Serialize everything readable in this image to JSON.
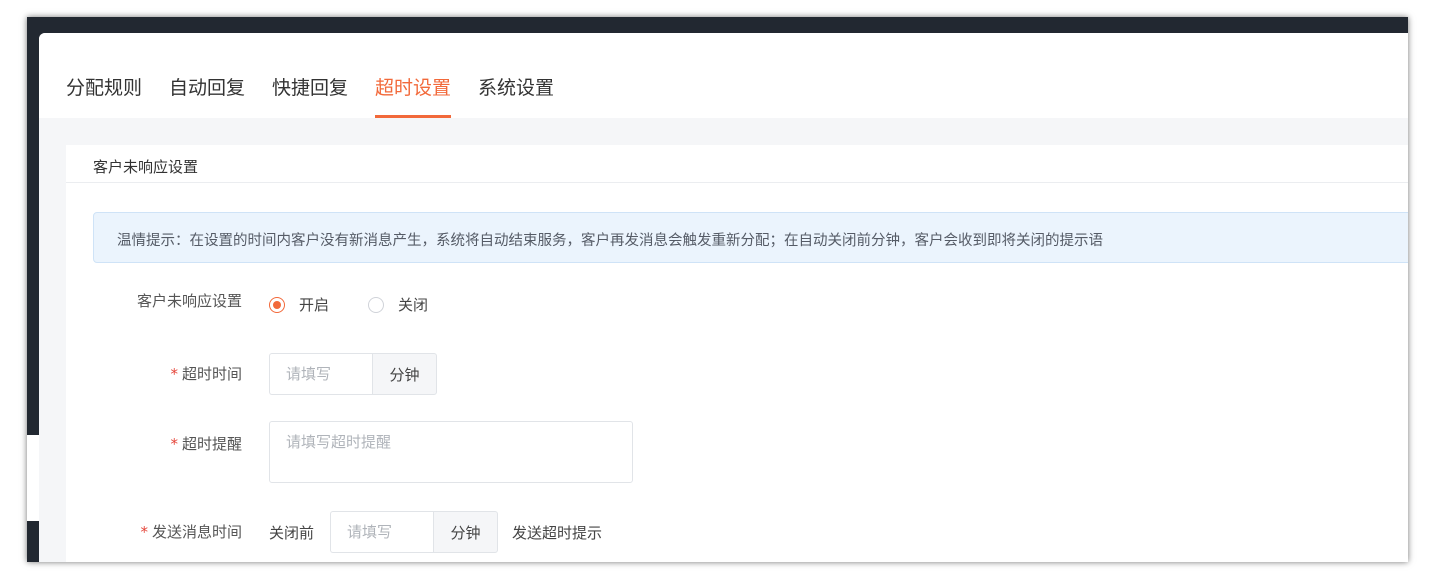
{
  "tabs": [
    {
      "label": "分配规则"
    },
    {
      "label": "自动回复"
    },
    {
      "label": "快捷回复"
    },
    {
      "label": "超时设置"
    },
    {
      "label": "系统设置"
    }
  ],
  "active_tab": "超时设置",
  "section": {
    "title": "客户未响应设置",
    "tip": "温情提示：在设置的时间内客户没有新消息产生，系统将自动结束服务，客户再发消息会触发重新分配；在自动关闭前分钟，客户会收到即将关闭的提示语"
  },
  "form": {
    "response_setting": {
      "label": "客户未响应设置",
      "options": [
        {
          "label": "开启",
          "checked": true
        },
        {
          "label": "关闭",
          "checked": false
        }
      ]
    },
    "timeout": {
      "required_mark": "*",
      "label": "超时时间",
      "placeholder": "请填写",
      "value": "",
      "unit": "分钟"
    },
    "timeout_reminder": {
      "required_mark": "*",
      "label": "超时提醒",
      "placeholder": "请填写超时提醒",
      "value": ""
    },
    "send_time": {
      "required_mark": "*",
      "label": "发送消息时间",
      "prefix": "关闭前",
      "placeholder": "请填写",
      "value": "",
      "unit": "分钟",
      "suffix": "发送超时提示"
    }
  },
  "colors": {
    "accent": "#f2693a",
    "required": "#e5463b",
    "tip_background": "#ebf4fd",
    "frame": "#222831"
  }
}
